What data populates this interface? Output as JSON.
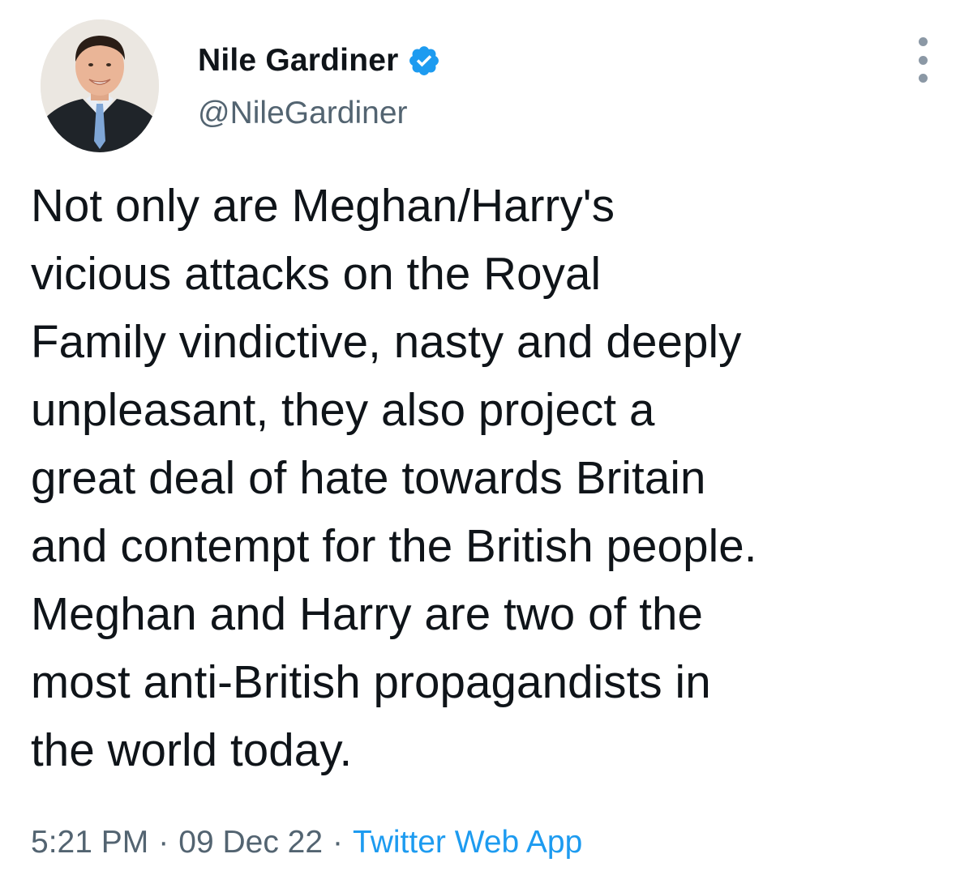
{
  "author": {
    "display_name": "Nile Gardiner",
    "handle": "@NileGardiner",
    "verified": true
  },
  "tweet": {
    "text": "Not only are Meghan/Harry's\nvicious attacks on the Royal\nFamily vindictive, nasty and deeply\nunpleasant, they also project a\ngreat deal of hate towards Britain\nand contempt for the British people.\nMeghan and Harry are two of the\nmost anti-British propagandists in\nthe world today.",
    "time": "5:21 PM",
    "separator": "·",
    "date": "09 Dec 22",
    "source": "Twitter Web App"
  },
  "icons": {
    "verified": "verified-badge-icon",
    "more": "more-options-icon"
  },
  "colors": {
    "text": "#0f1419",
    "secondary": "#536471",
    "accent": "#1d9bf0"
  }
}
